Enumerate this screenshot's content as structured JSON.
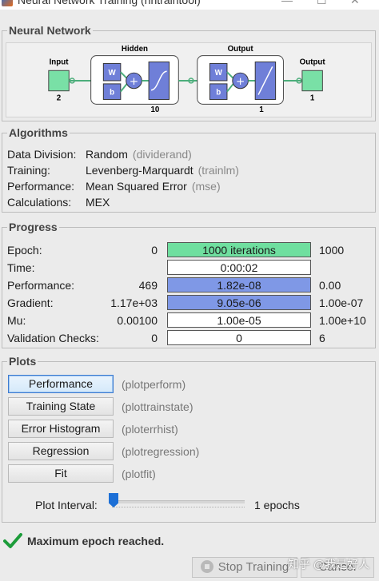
{
  "window": {
    "title": "Neural Network Training (nntraintool)",
    "minimize_glyph": "—",
    "maximize_glyph": "☐",
    "close_glyph": "✕",
    "icon": "matlab-icon"
  },
  "network": {
    "section_title": "Neural Network",
    "input_label": "Input",
    "input_size": "2",
    "hidden_label": "Hidden",
    "hidden_size": "10",
    "output_layer_label": "Output",
    "output_layer_size": "1",
    "output_label": "Output",
    "output_size": "1",
    "w_label": "W",
    "b_label": "b"
  },
  "algorithms": {
    "section_title": "Algorithms",
    "rows": [
      {
        "label": "Data Division:",
        "value": "Random",
        "func": "(dividerand)"
      },
      {
        "label": "Training:",
        "value": "Levenberg-Marquardt",
        "func": "(trainlm)"
      },
      {
        "label": "Performance:",
        "value": "Mean Squared Error",
        "func": "(mse)"
      },
      {
        "label": "Calculations:",
        "value": "MEX",
        "func": ""
      }
    ]
  },
  "progress": {
    "section_title": "Progress",
    "rows": [
      {
        "label": "Epoch:",
        "min": "0",
        "current": "1000 iterations",
        "max": "1000",
        "fill_fraction": 1.0,
        "fill_color": "#6fdf9f"
      },
      {
        "label": "Time:",
        "min": "",
        "current": "0:00:02",
        "max": "",
        "fill_fraction": 0,
        "fill_color": "#ffffff"
      },
      {
        "label": "Performance:",
        "min": "469",
        "current": "1.82e-08",
        "max": "0.00",
        "fill_fraction": 1.0,
        "fill_color": "#7f98e6"
      },
      {
        "label": "Gradient:",
        "min": "1.17e+03",
        "current": "9.05e-06",
        "max": "1.00e-07",
        "fill_fraction": 1.0,
        "fill_color": "#7f98e6"
      },
      {
        "label": "Mu:",
        "min": "0.00100",
        "current": "1.00e-05",
        "max": "1.00e+10",
        "fill_fraction": 0,
        "fill_color": "#ffffff"
      },
      {
        "label": "Validation Checks:",
        "min": "0",
        "current": "0",
        "max": "6",
        "fill_fraction": 0,
        "fill_color": "#ffffff"
      }
    ]
  },
  "plots": {
    "section_title": "Plots",
    "buttons": [
      {
        "label": "Performance",
        "func": "(plotperform)"
      },
      {
        "label": "Training State",
        "func": "(plottrainstate)"
      },
      {
        "label": "Error Histogram",
        "func": "(ploterrhist)"
      },
      {
        "label": "Regression",
        "func": "(plotregression)"
      },
      {
        "label": "Fit",
        "func": "(plotfit)"
      }
    ],
    "interval_label": "Plot Interval:",
    "interval_value": "1 epochs"
  },
  "status": {
    "message": "Maximum epoch reached.",
    "icon": "checkmark-icon"
  },
  "footer": {
    "stop_label": "Stop Training",
    "cancel_label": "Cancel"
  },
  "watermark": "知乎 @我是好人"
}
